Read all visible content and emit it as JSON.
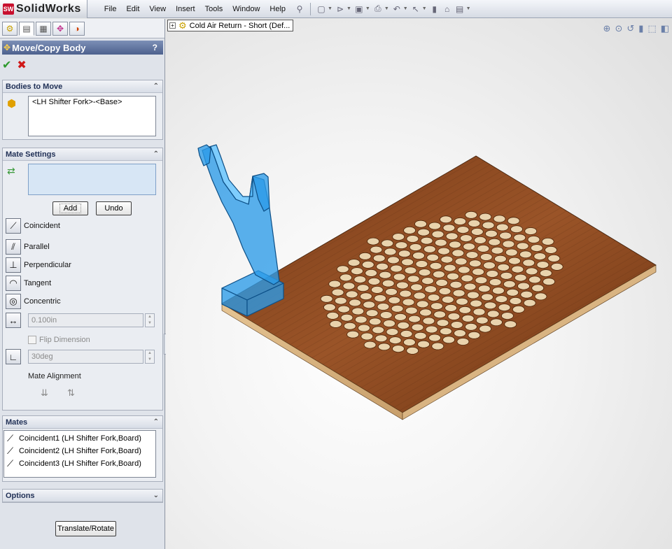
{
  "app": {
    "name": "SolidWorks",
    "logo_mark": "SW"
  },
  "menus": [
    "File",
    "Edit",
    "View",
    "Insert",
    "Tools",
    "Window",
    "Help"
  ],
  "toolbar_icons": [
    "pin-icon",
    "new-document-icon",
    "open-icon",
    "save-icon",
    "print-icon",
    "undo-icon",
    "select-icon",
    "rebuild-icon",
    "options-icon",
    "view-icon"
  ],
  "panel_tabs": [
    "feature-manager-icon",
    "property-manager-icon",
    "configuration-manager-icon",
    "dimxpert-icon",
    "display-manager-icon"
  ],
  "property_manager": {
    "title": "Move/Copy Body",
    "help": "?",
    "ok": "✔",
    "cancel": "✖"
  },
  "bodies_to_move": {
    "header": "Bodies to Move",
    "selection": "<LH Shifter Fork>-<Base>"
  },
  "mate_settings": {
    "header": "Mate Settings",
    "add_label": "Add",
    "undo_label": "Undo",
    "coincident": "Coincident",
    "parallel": "Parallel",
    "perpendicular": "Perpendicular",
    "tangent": "Tangent",
    "concentric": "Concentric",
    "distance_value": "0.100in",
    "flip_dimension": "Flip Dimension",
    "angle_value": "30deg",
    "mate_alignment": "Mate Alignment"
  },
  "mates": {
    "header": "Mates",
    "items": [
      "Coincident1 (LH Shifter Fork,Board)",
      "Coincident2 (LH Shifter Fork,Board)",
      "Coincident3 (LH Shifter Fork,Board)"
    ]
  },
  "options": {
    "header": "Options"
  },
  "translate_rotate_label": "Translate/Rotate",
  "tree": {
    "label": "Cold Air Return - Short (Def..."
  },
  "view_tools": [
    "zoom-to-fit-icon",
    "zoom-area-icon",
    "previous-view-icon",
    "section-view-icon",
    "view-orientation-icon",
    "display-style-icon"
  ],
  "colors": {
    "selection_blue": "#2b9be8",
    "wood": "#8a4a22",
    "title_bar": "#5a6e98"
  }
}
